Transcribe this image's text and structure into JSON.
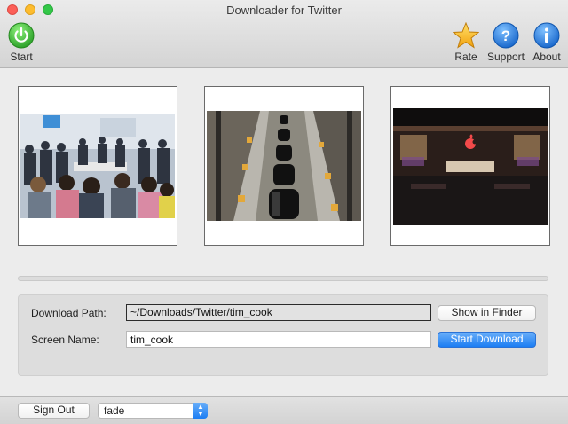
{
  "window": {
    "title": "Downloader for Twitter"
  },
  "toolbar": {
    "start_label": "Start",
    "rate_label": "Rate",
    "support_label": "Support",
    "about_label": "About",
    "icons": {
      "start": "power-icon",
      "rate": "star-icon",
      "support": "question-icon",
      "about": "info-icon"
    },
    "colors": {
      "start": "#3fbf3a",
      "rate": "#f5b21c",
      "support": "#1f7fe0",
      "about": "#1f7fe0"
    }
  },
  "thumbnails": [
    {
      "subject": "crowd at apple store event"
    },
    {
      "subject": "mac pro assembly line"
    },
    {
      "subject": "apple store at night"
    }
  ],
  "progress": {
    "value": 0
  },
  "settings": {
    "download_path_label": "Download Path:",
    "download_path_value": "~/Downloads/Twitter/tim_cook",
    "show_in_finder_label": "Show in Finder",
    "screen_name_label": "Screen Name:",
    "screen_name_value": "tim_cook",
    "start_download_label": "Start Download"
  },
  "bottom": {
    "sign_out_label": "Sign Out",
    "transition_selected": "fade"
  }
}
